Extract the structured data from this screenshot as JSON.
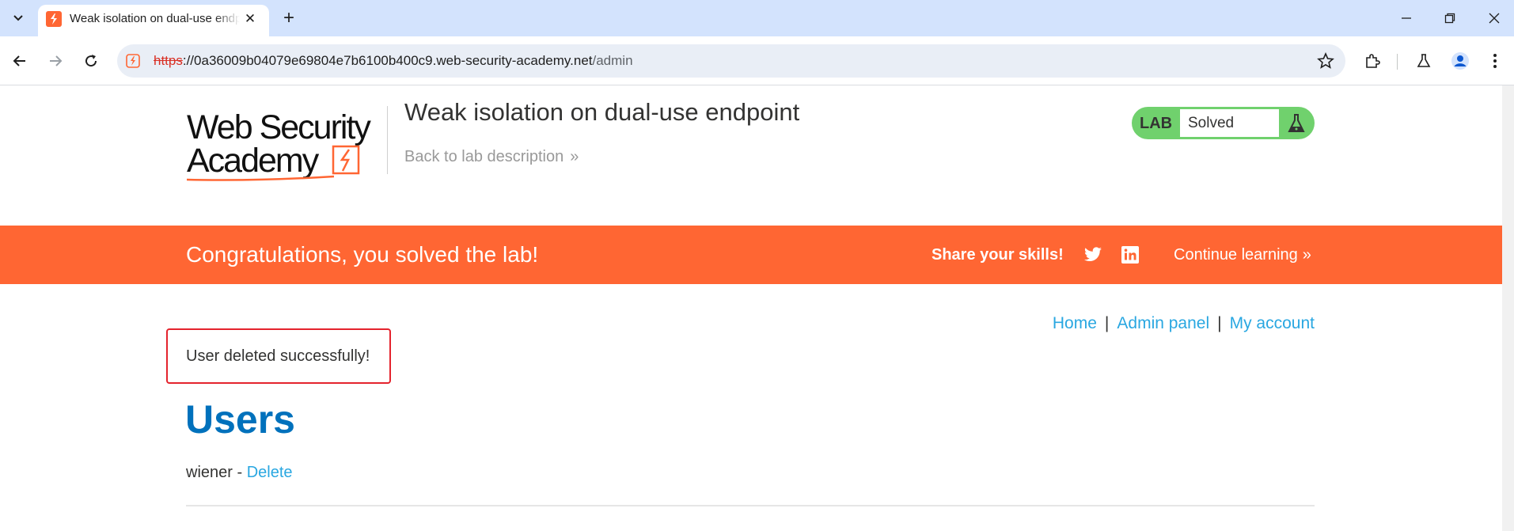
{
  "browser": {
    "tab_title": "Weak isolation on dual-use endpoint",
    "url": {
      "scheme": "https",
      "rest": "://0a36009b04079e69804e7b6100b400c9.web-security-academy.net",
      "path": "/admin"
    },
    "icons": [
      "tab-list-icon",
      "favicon-icon",
      "close-icon",
      "new-tab-icon",
      "minimize-icon",
      "restore-icon",
      "window-close-icon",
      "back-icon",
      "forward-icon",
      "reload-icon",
      "site-info-icon",
      "bookmark-star-icon",
      "extensions-icon",
      "labs-flask-icon",
      "profile-icon",
      "menu-kebab-icon"
    ]
  },
  "header": {
    "logo_line1": "Web Security",
    "logo_line2": "Academy",
    "lab_title": "Weak isolation on dual-use endpoint",
    "back_link": "Back to lab description",
    "back_chevron": "»",
    "lab_badge": "LAB",
    "lab_status": "Solved"
  },
  "banner": {
    "message": "Congratulations, you solved the lab!",
    "share": "Share your skills!",
    "continue": "Continue learning",
    "continue_chevron": "»"
  },
  "nav": {
    "home": "Home",
    "sep1": "|",
    "admin": "Admin panel",
    "sep2": "|",
    "account": "My account"
  },
  "main": {
    "alert": "User deleted successfully!",
    "heading": "Users",
    "users": [
      {
        "name": "wiener",
        "separator": " - ",
        "action": "Delete"
      }
    ]
  },
  "colors": {
    "accent_orange": "#ff6633",
    "status_green": "#70d16d",
    "heading_blue": "#0071bc",
    "link_blue": "#29a7e1",
    "alert_red": "#e4232d"
  }
}
